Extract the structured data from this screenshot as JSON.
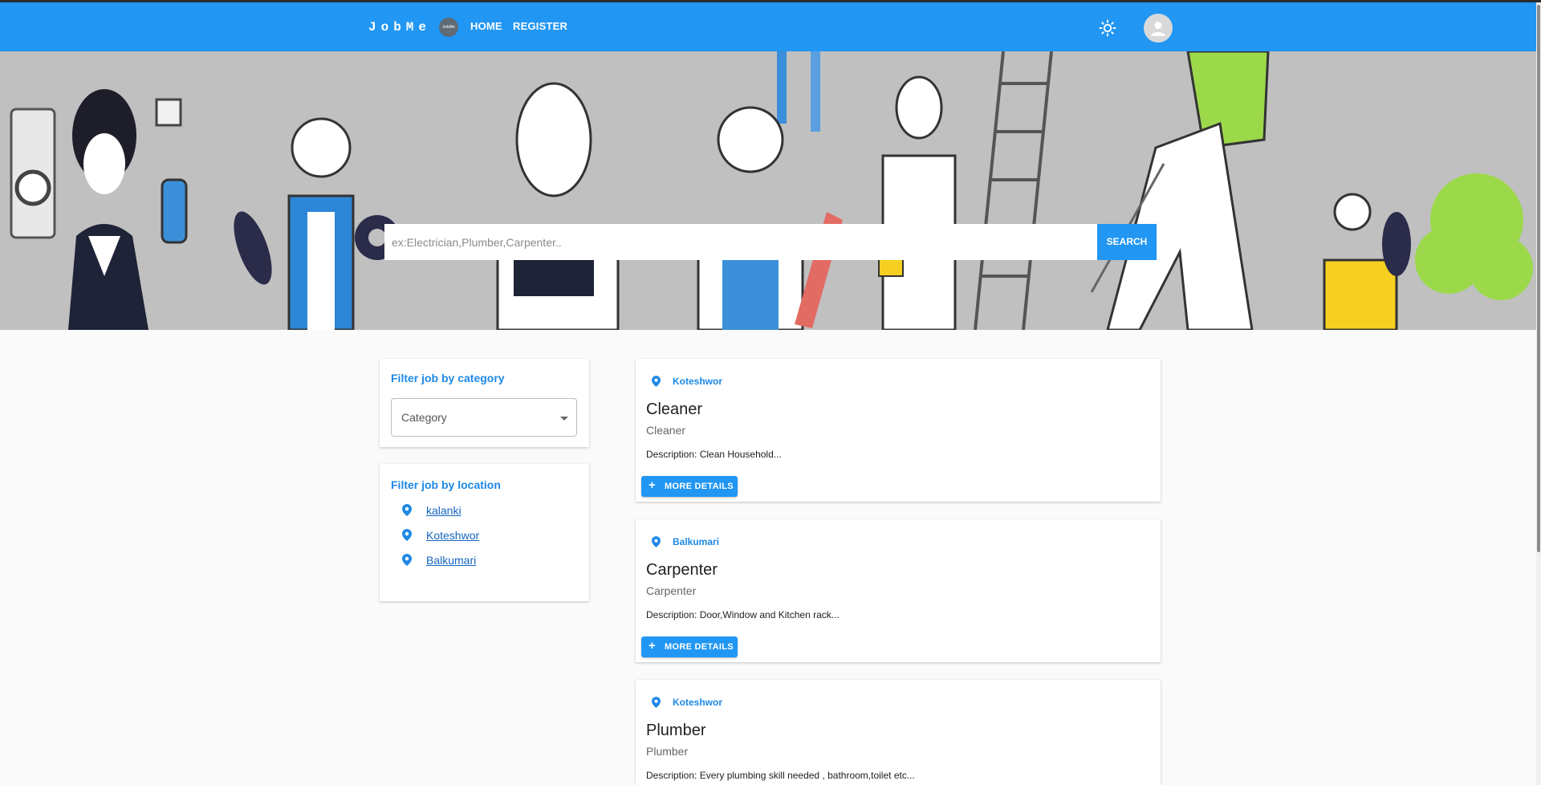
{
  "app": {
    "brand": "JobMe",
    "logo_text": "JobMe",
    "accent_color": "#2196f3",
    "link_color": "#1565c0"
  },
  "nav": {
    "items": [
      {
        "label": "HOME"
      },
      {
        "label": "REGISTER"
      }
    ],
    "theme_icon": "sun-icon",
    "account_icon": "account-circle-icon"
  },
  "hero": {
    "image": "workers-illustration",
    "search": {
      "placeholder": "ex:Electrician,Plumber,Carpenter..",
      "value": "",
      "button_label": "SEARCH"
    }
  },
  "filters": {
    "category": {
      "title": "Filter job by category",
      "select_label": "Category"
    },
    "location": {
      "title": "Filter job by location",
      "items": [
        "kalanki",
        "Koteshwor",
        "Balkumari"
      ]
    }
  },
  "jobs": [
    {
      "location": "Koteshwor",
      "title": "Cleaner",
      "category": "Cleaner",
      "description": "Description: Clean Household...",
      "button_label": "MORE DETAILS"
    },
    {
      "location": "Balkumari",
      "title": "Carpenter",
      "category": "Carpenter",
      "description": "Description: Door,Window and Kitchen rack...",
      "button_label": "MORE DETAILS"
    },
    {
      "location": "Koteshwor",
      "title": "Plumber",
      "category": "Plumber",
      "description": "Description: Every plumbing skill needed , bathroom,toilet etc..."
    }
  ]
}
